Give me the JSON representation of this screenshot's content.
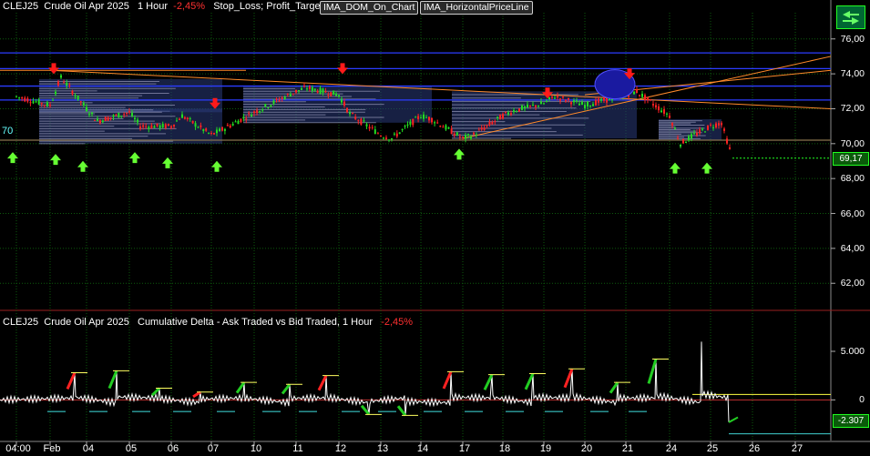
{
  "header": {
    "symbol": "CLEJ25",
    "name": "Crude Oil Apr 2025",
    "timeframe": "1 Hour",
    "change": "-2,45%",
    "studies": "Stop_Loss; Profit_Target"
  },
  "buttons": {
    "dom_on_chart": "IMA_DOM_On_Chart",
    "horizontal_price_line": "IMA_HorizontalPriceLine"
  },
  "lower_header": {
    "symbol": "CLEJ25",
    "name": "Crude Oil Apr 2025",
    "study": "Cumulative Delta - Ask Traded vs Bid Traded, 1 Hour",
    "change": "-2,45%"
  },
  "left_label": "70",
  "last_price": "69,17",
  "last_delta": "-2.307",
  "x_labels": [
    "04:00",
    "Feb",
    "04",
    "05",
    "06",
    "07",
    "10",
    "11",
    "12",
    "13",
    "14",
    "17",
    "18",
    "19",
    "20",
    "21",
    "24",
    "25",
    "26",
    "27"
  ],
  "colors": {
    "up_candle": "#22dd22",
    "down_candle": "#ff2222",
    "arrow_up": "#66ff33",
    "arrow_down": "#ff1a1a",
    "trendline": "#ff8a2a",
    "delta_line": "#ffffff",
    "grid": "#0d5a0d"
  },
  "chart_data": [
    {
      "type": "candlestick",
      "title": "CLEJ25  Crude Oil Apr 2025  1 Hour",
      "y_ticks": [
        "76,00",
        "74,00",
        "72,00",
        "70,00",
        "68,00",
        "66,00",
        "64,00",
        "62,00"
      ],
      "ylim": [
        60.5,
        77.5
      ],
      "price_path": [
        [
          "04:00",
          72.7
        ],
        [
          "Feb",
          72.2
        ],
        [
          "Feb",
          73.8
        ],
        [
          "04",
          72.0
        ],
        [
          "04",
          71.3
        ],
        [
          "05",
          71.8
        ],
        [
          "05",
          71.0
        ],
        [
          "06",
          71.0
        ],
        [
          "06",
          71.6
        ],
        [
          "07",
          70.5
        ],
        [
          "07",
          70.8
        ],
        [
          "10",
          71.8
        ],
        [
          "11",
          73.0
        ],
        [
          "11",
          73.2
        ],
        [
          "12",
          72.8
        ],
        [
          "12",
          71.7
        ],
        [
          "13",
          70.5
        ],
        [
          "13",
          70.3
        ],
        [
          "14",
          71.6
        ],
        [
          "14",
          71.4
        ],
        [
          "17",
          70.3
        ],
        [
          "17",
          70.5
        ],
        [
          "18",
          71.6
        ],
        [
          "18",
          71.9
        ],
        [
          "19",
          72.3
        ],
        [
          "19",
          72.7
        ],
        [
          "20",
          72.2
        ],
        [
          "21",
          72.8
        ],
        [
          "21",
          73.0
        ],
        [
          "21",
          72.5
        ],
        [
          "24",
          71.6
        ],
        [
          "24",
          70.0
        ],
        [
          "24",
          70.4
        ],
        [
          "25",
          71.0
        ],
        [
          "25",
          71.2
        ],
        [
          "25",
          69.17
        ]
      ],
      "last_price": 69.17,
      "arrows_up_at": [
        "04:00",
        "Feb",
        "04",
        "05",
        "06",
        "07",
        "17",
        "24",
        "25"
      ],
      "arrows_down_at": [
        "Feb",
        "07",
        "12",
        "19",
        "21"
      ]
    },
    {
      "type": "line",
      "title": "Cumulative Delta - Ask Traded vs Bid Traded, 1 Hour",
      "y_ticks": [
        "5.000",
        "0"
      ],
      "ylim": [
        -4000,
        8000
      ],
      "last_value": -2307
    }
  ]
}
